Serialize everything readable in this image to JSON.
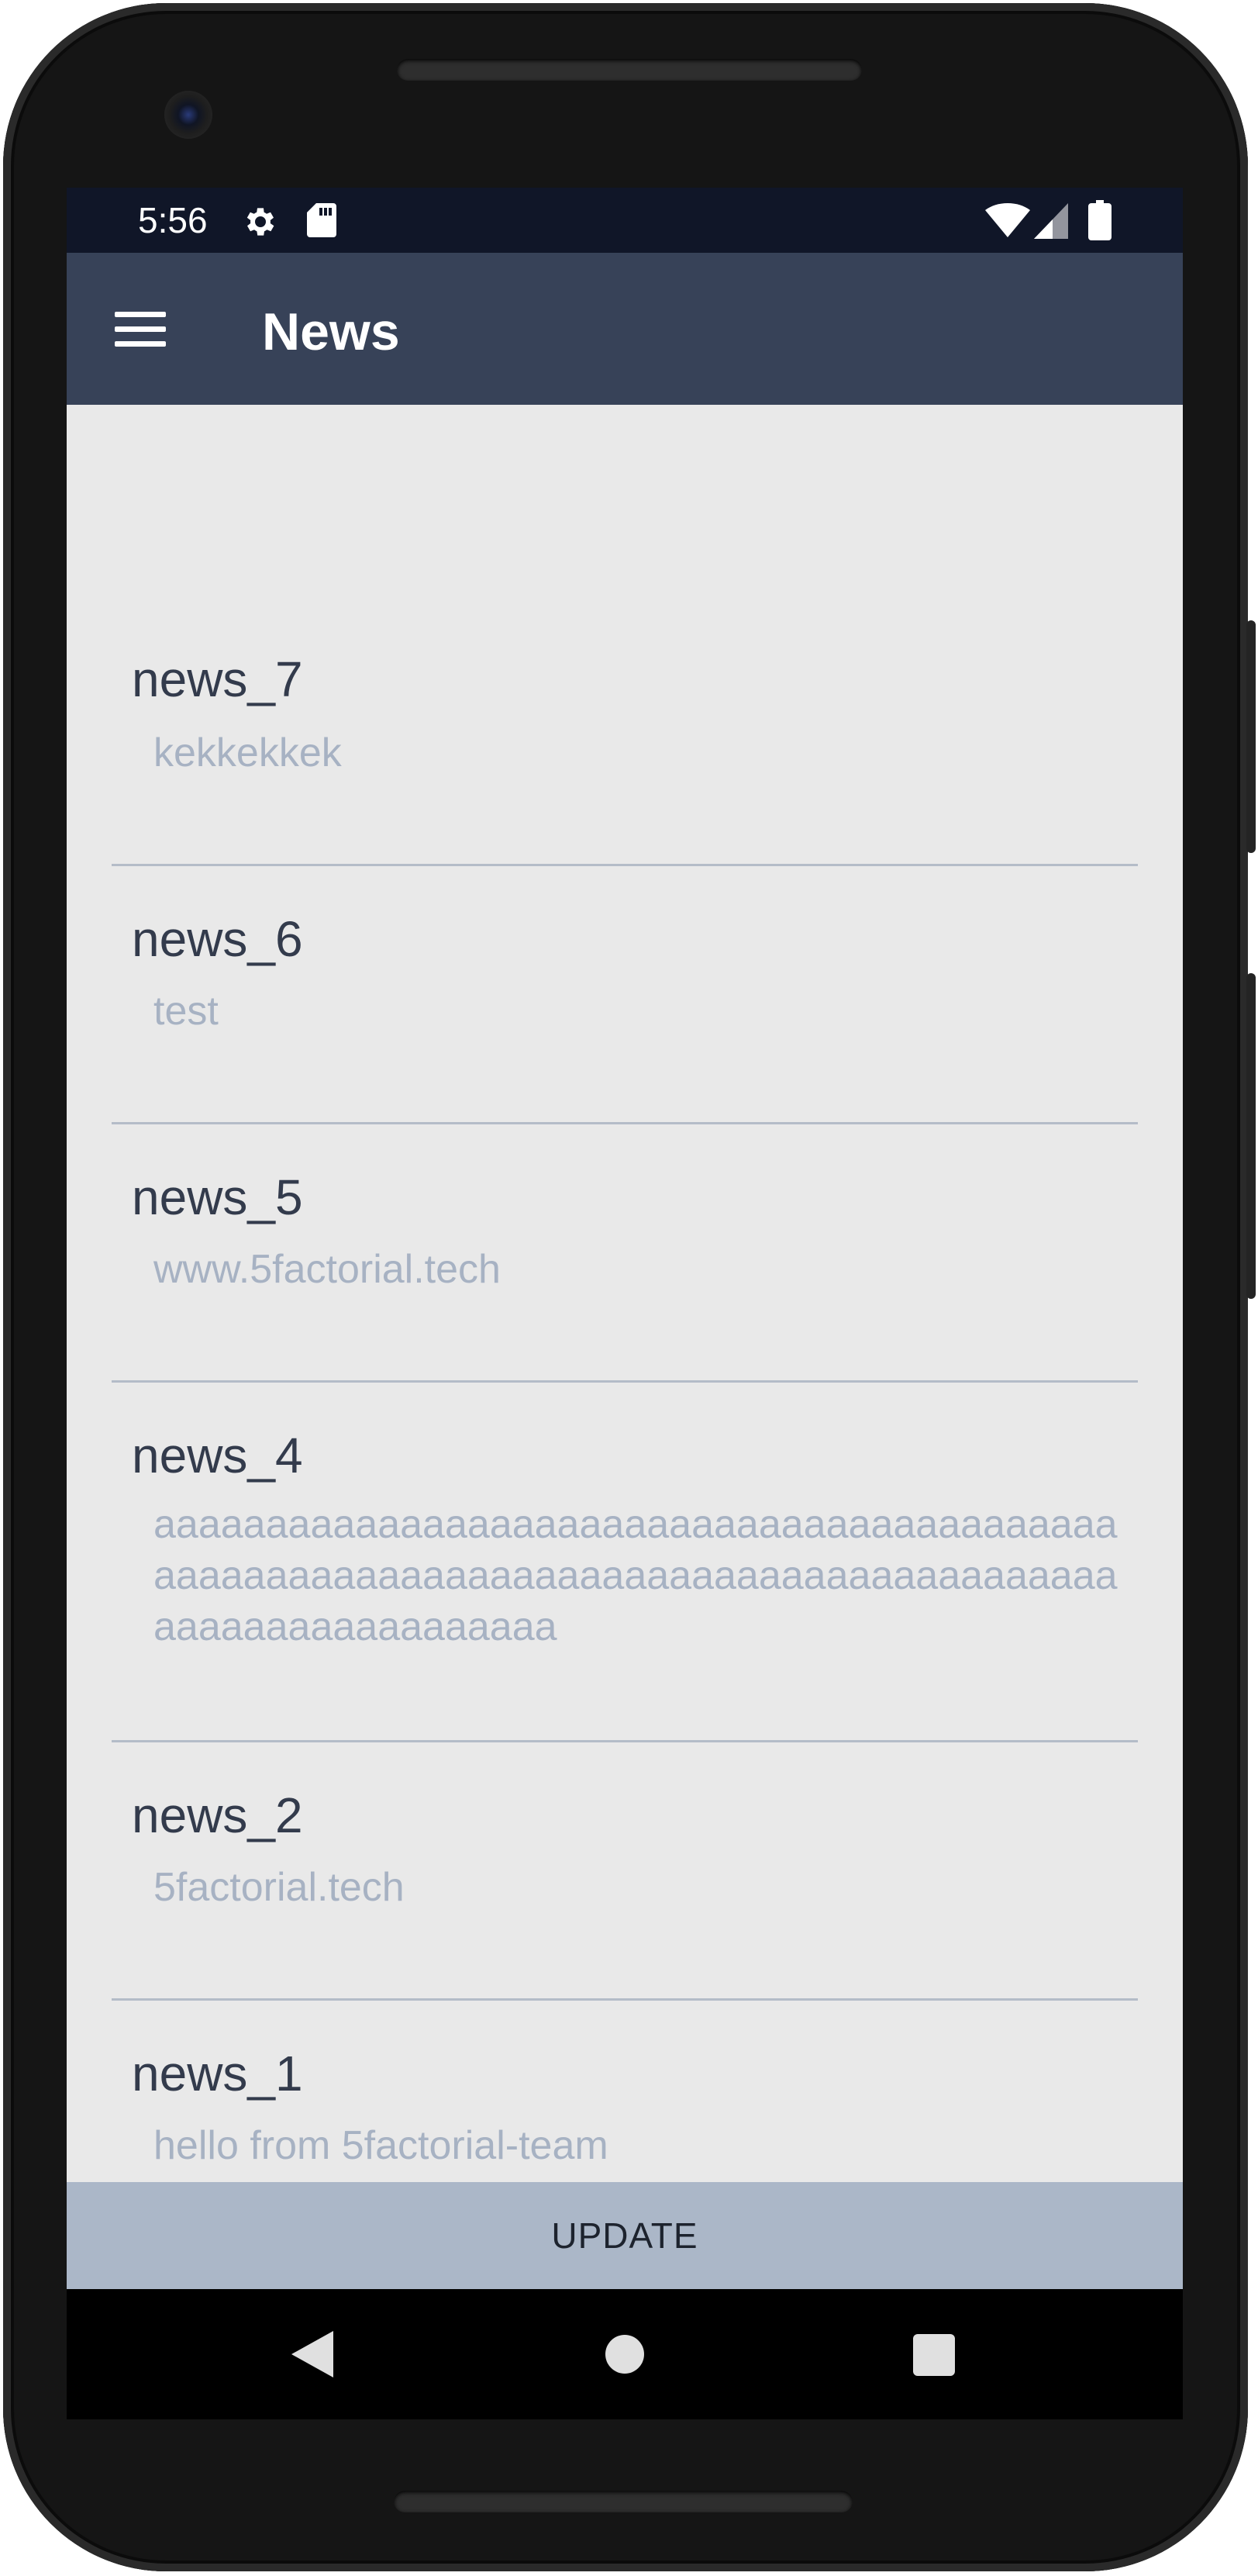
{
  "status_bar": {
    "time": "5:56",
    "icons": [
      "gear-icon",
      "sd-card-icon",
      "wifi-icon",
      "signal-icon",
      "battery-icon"
    ]
  },
  "app_bar": {
    "menu_icon": "hamburger-menu-icon",
    "title": "News"
  },
  "news": [
    {
      "title": "news_7",
      "body": "kekkekkek"
    },
    {
      "title": "news_6",
      "body": "test"
    },
    {
      "title": "news_5",
      "body": "www.5factorial.tech"
    },
    {
      "title": "news_4",
      "body": "aaaaaaaaaaaaaaaaaaaaaaaaaaaaaaaaaaaaaaaaaaaaaaaaaaaaaaaaaaaaaaaaaaaaaaaaaaaaaaaaaaaaaaaaaaaaaaaaaaaaaaaa"
    },
    {
      "title": "news_2",
      "body": "5factorial.tech"
    },
    {
      "title": "news_1",
      "body": "hello from 5factorial-team"
    }
  ],
  "update_button": {
    "label": "UPDATE"
  },
  "nav_bar": {
    "icons": [
      "back-icon",
      "home-icon",
      "recents-icon"
    ]
  },
  "colors": {
    "status_bar": "#101628",
    "app_bar": "#374258",
    "background": "#e9e9e9",
    "title_text": "#333b4c",
    "body_text": "#a7b2c3",
    "divider": "#b4bcc8",
    "update_bar": "#abb7c8"
  }
}
